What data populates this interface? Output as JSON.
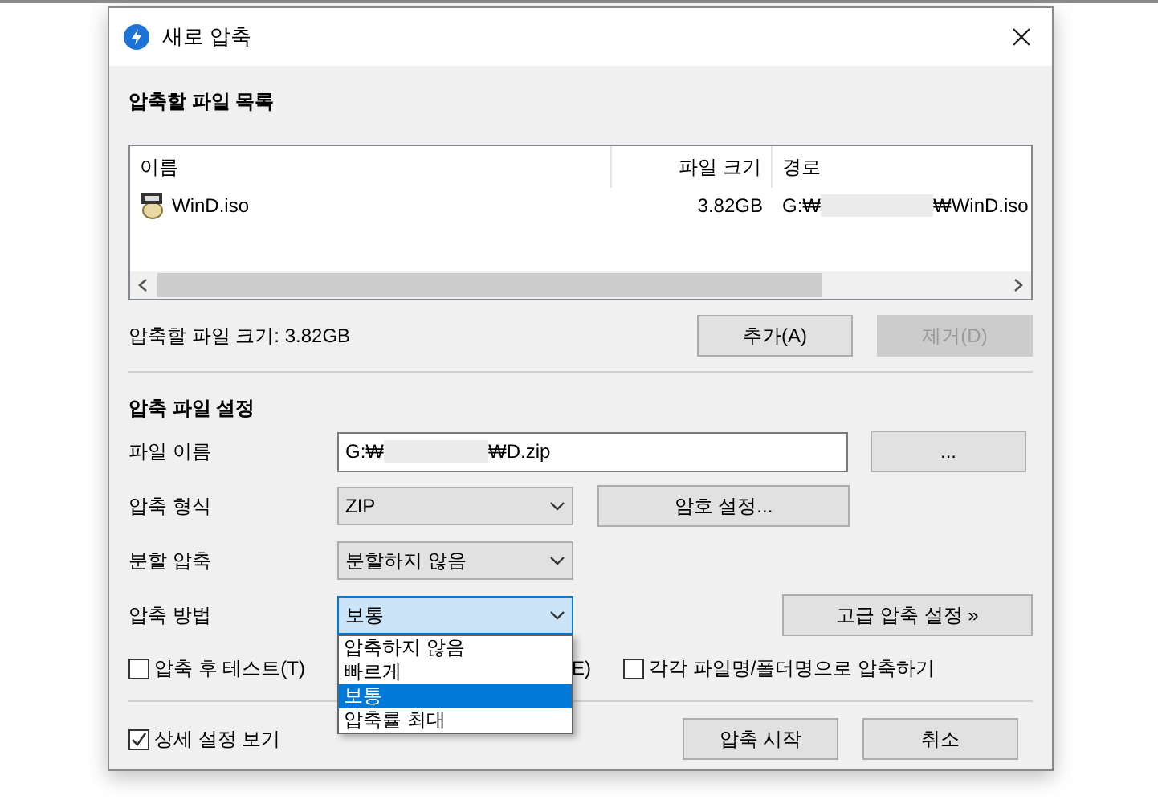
{
  "window": {
    "title": "새로 압축"
  },
  "file_list": {
    "heading": "압축할 파일 목록",
    "columns": [
      "이름",
      "파일 크기",
      "경로"
    ],
    "rows": [
      {
        "name": "WinD.iso",
        "size": "3.82GB",
        "path_start": "G:₩",
        "path_end": "₩WinD.iso"
      }
    ],
    "total": "압축할 파일 크기: 3.82GB",
    "buttons": [
      {
        "label": "추가(A)",
        "disabled": false
      },
      {
        "label": "제거(D)",
        "disabled": true
      }
    ]
  },
  "settings": {
    "heading": "압축 파일 설정",
    "file_name": {
      "label": "파일 이름",
      "value_start": "G:₩",
      "value_end": "₩D.zip",
      "button": "..."
    },
    "format": {
      "label": "압축 형식",
      "value": "ZIP",
      "button": "암호 설정..."
    },
    "split": {
      "label": "분할 압축",
      "value": "분할하지 않음"
    },
    "method": {
      "label": "압축 방법",
      "value": "보통",
      "expanded": true,
      "button": "고급 압축 설정 »",
      "options": [
        {
          "label": "압축하지 않음",
          "selected": false
        },
        {
          "label": "빠르게",
          "selected": false
        },
        {
          "label": "보통",
          "selected": true
        },
        {
          "label": "압축률 최대",
          "selected": false
        }
      ]
    },
    "checkboxes": [
      {
        "label": "압축 후 테스트(T)",
        "checked": false
      },
      {
        "label": "E)",
        "kind": "covered"
      },
      {
        "label": "각각 파일명/폴더명으로 압축하기",
        "checked": false
      }
    ]
  },
  "footer": {
    "details": {
      "label": "상세 설정 보기",
      "checked": true
    },
    "buttons": [
      "압축 시작",
      "취소"
    ]
  }
}
